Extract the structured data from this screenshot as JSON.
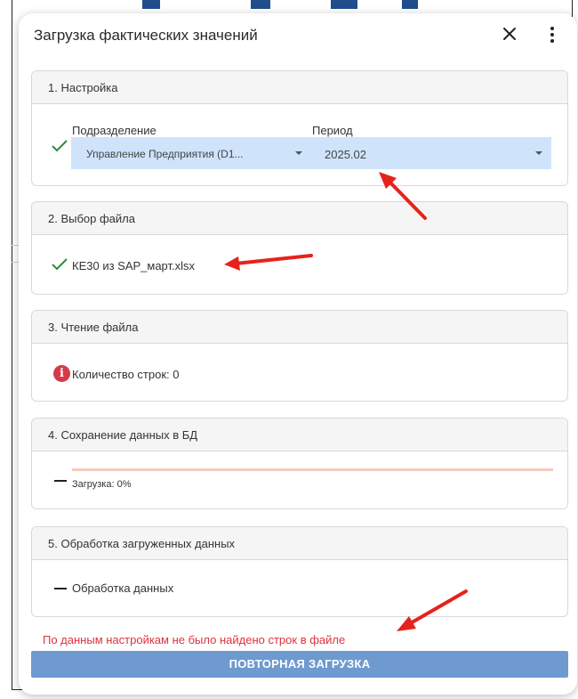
{
  "dialog": {
    "title": "Загрузка фактических значений",
    "close_icon": "close-icon",
    "more_icon": "more-vertical-icon"
  },
  "steps": {
    "setup": {
      "header": "1. Настройка",
      "department_label": "Подразделение",
      "department_value": "Управление Предприятия (D1...",
      "period_label": "Период",
      "period_value": "2025.02",
      "status_icon": "check-icon"
    },
    "file": {
      "header": "2. Выбор файла",
      "file_name": "КЕ30 из SAP_март.xlsx",
      "status_icon": "check-icon"
    },
    "read": {
      "header": "3. Чтение файла",
      "rows_text": "Количество строк: 0",
      "status_icon": "info-icon"
    },
    "save": {
      "header": "4. Сохранение данных в БД",
      "progress_text": "Загрузка: 0%",
      "progress": 0,
      "status_icon": "dash-icon"
    },
    "process": {
      "header": "5. Обработка загруженных данных",
      "status_text": "Обработка данных",
      "status_icon": "dash-icon"
    }
  },
  "error_message": "По данным настройкам не было найдено строк в файле",
  "retry_button": "ПОВТОРНАЯ ЗАГРУЗКА",
  "colors": {
    "select_bg": "#cfe3fb",
    "check": "#2e8b3e",
    "error": "#e0323c",
    "info": "#d63a4a",
    "button": "#6f9ad0",
    "progress_track": "#f7c9c0",
    "annotation_arrow": "#e5231b"
  }
}
